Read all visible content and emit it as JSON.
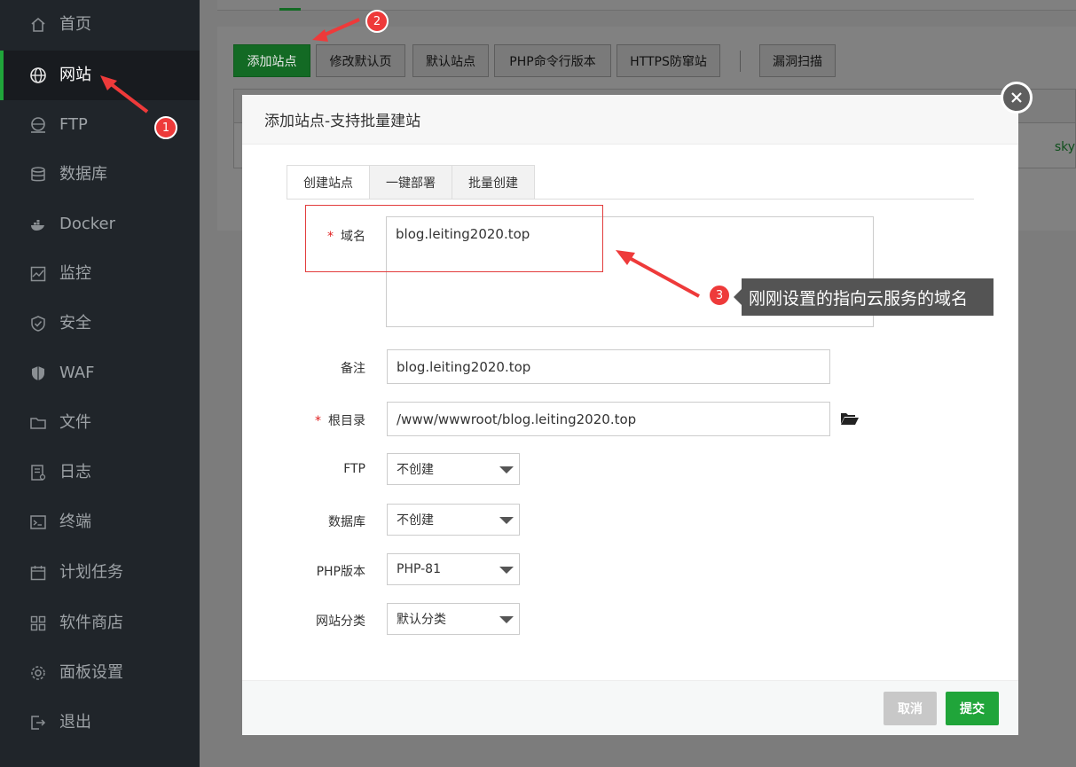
{
  "sidebar": {
    "items": [
      {
        "label": "首页",
        "icon": "home-icon"
      },
      {
        "label": "网站",
        "icon": "globe-icon",
        "active": true
      },
      {
        "label": "FTP",
        "icon": "ftp-globe-icon"
      },
      {
        "label": "数据库",
        "icon": "database-icon"
      },
      {
        "label": "Docker",
        "icon": "docker-icon"
      },
      {
        "label": "监控",
        "icon": "monitor-icon"
      },
      {
        "label": "安全",
        "icon": "shield-icon"
      },
      {
        "label": "WAF",
        "icon": "waf-shield-icon"
      },
      {
        "label": "文件",
        "icon": "folder-icon"
      },
      {
        "label": "日志",
        "icon": "log-icon"
      },
      {
        "label": "终端",
        "icon": "terminal-icon"
      },
      {
        "label": "计划任务",
        "icon": "calendar-icon"
      },
      {
        "label": "软件商店",
        "icon": "apps-grid-icon"
      },
      {
        "label": "面板设置",
        "icon": "gear-icon"
      },
      {
        "label": "退出",
        "icon": "logout-icon"
      }
    ]
  },
  "toolbar": {
    "add_site": "添加站点",
    "edit_default_page": "修改默认页",
    "default_site": "默认站点",
    "php_cli_version": "PHP命令行版本",
    "https_protect": "HTTPS防窜站",
    "vuln_scan": "漏洞扫描"
  },
  "background_table": {
    "partial_text": "sky"
  },
  "modal": {
    "title": "添加站点-支持批量建站",
    "tabs": [
      "创建站点",
      "一键部署",
      "批量创建"
    ],
    "form": {
      "domain_label": "域名",
      "domain_value": "blog.leiting2020.top",
      "note_label": "备注",
      "note_value": "blog.leiting2020.top",
      "root_label": "根目录",
      "root_value": "/www/wwwroot/blog.leiting2020.top",
      "ftp_label": "FTP",
      "ftp_value": "不创建",
      "db_label": "数据库",
      "db_value": "不创建",
      "php_label": "PHP版本",
      "php_value": "PHP-81",
      "category_label": "网站分类",
      "category_value": "默认分类"
    },
    "cancel": "取消",
    "submit": "提交"
  },
  "annotations": {
    "badge1": "1",
    "badge2": "2",
    "badge3": "3",
    "callout": "刚刚设置的指向云服务的域名"
  },
  "colors": {
    "accent_green": "#20a53a",
    "sidebar_bg": "#20252a",
    "annotation_red": "#ee3a3a"
  }
}
